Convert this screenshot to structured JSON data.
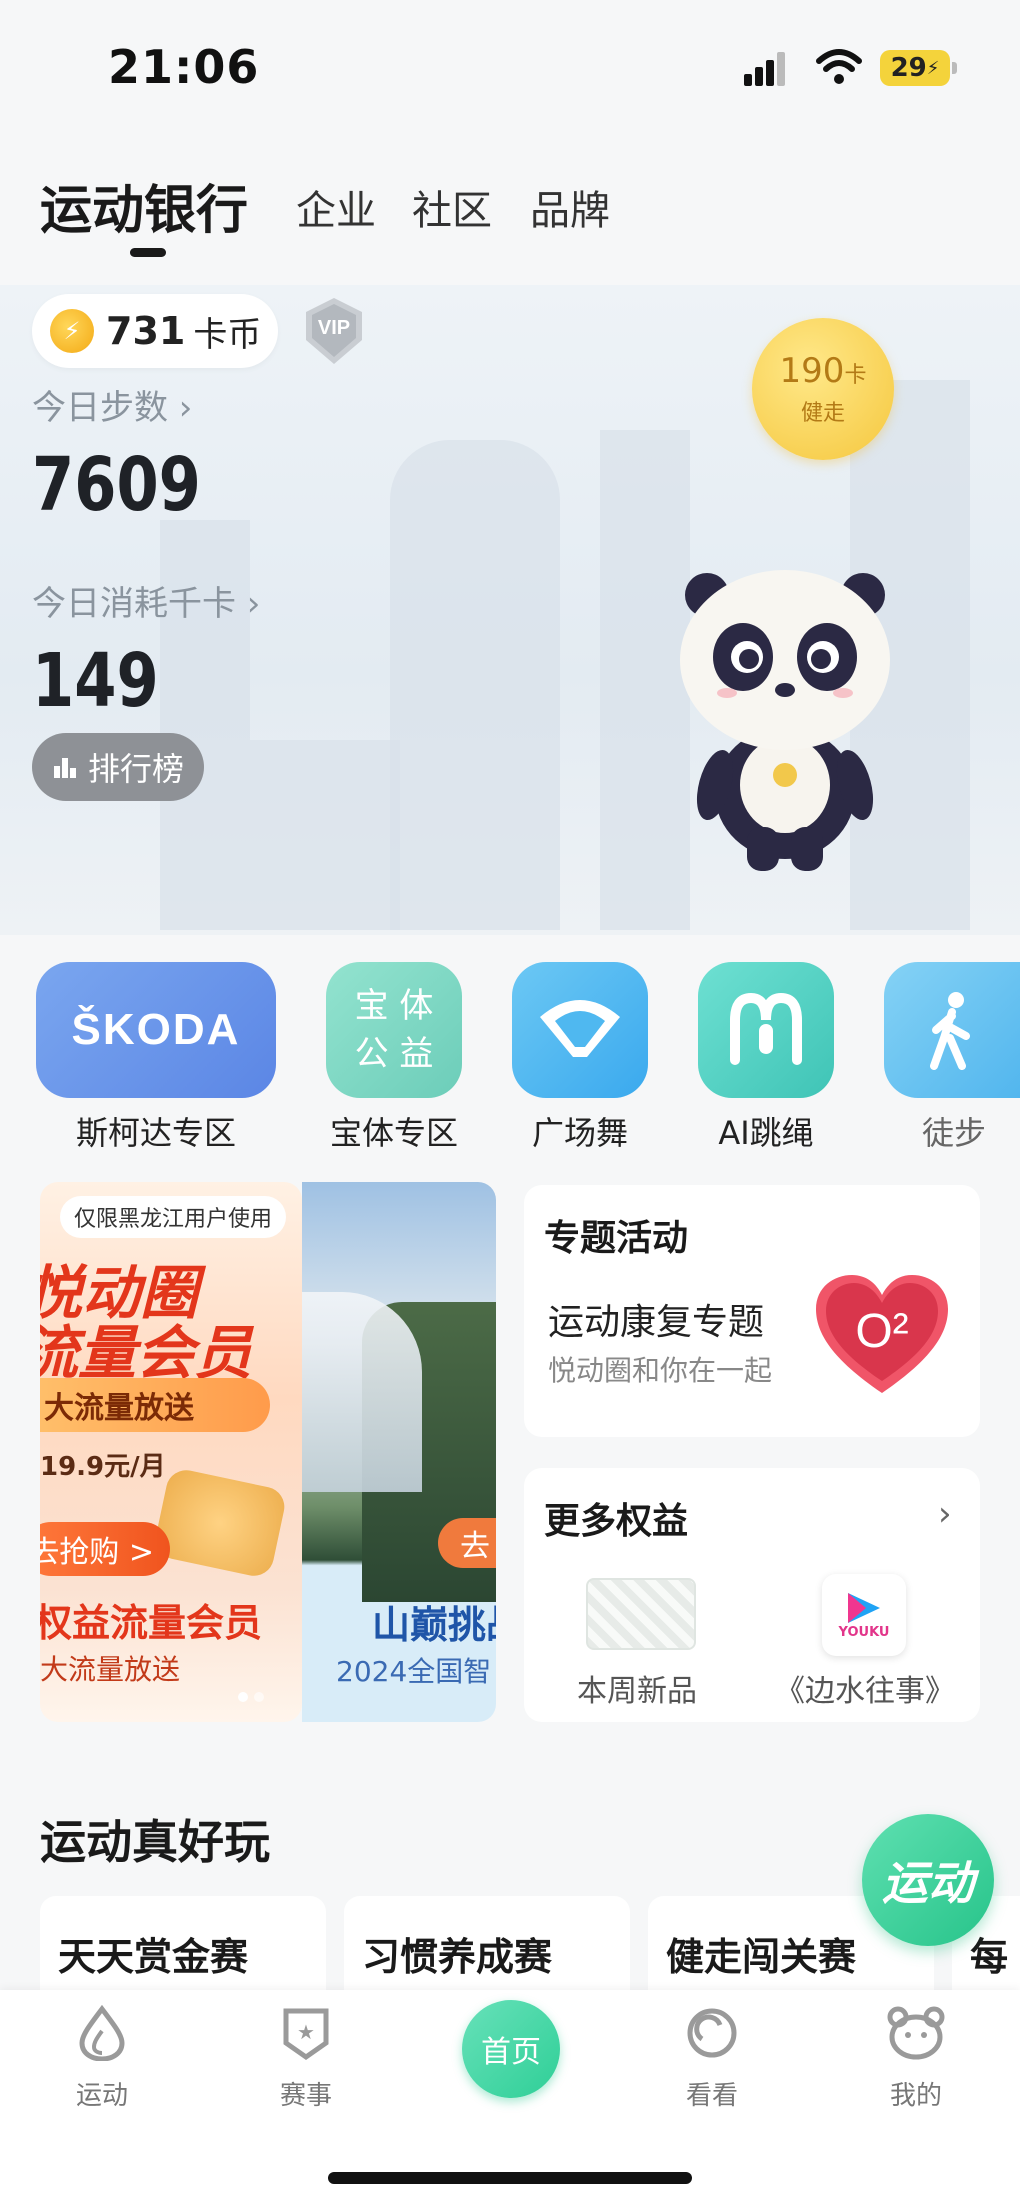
{
  "status_bar": {
    "time": "21:06",
    "battery": "29"
  },
  "top_tabs": [
    "运动银行",
    "企业",
    "社区",
    "品牌"
  ],
  "hero": {
    "coins": "731",
    "coin_unit": "卡币",
    "vip": "VIP",
    "steps_label": "今日步数",
    "steps": "7609",
    "calories_label": "今日消耗千卡",
    "calories": "149",
    "rank_button": "排行榜",
    "badge_value": "190",
    "badge_unit": "卡",
    "badge_label": "健走"
  },
  "shortcuts": [
    {
      "label": "斯柯达专区",
      "icon_text": "ŠKODA",
      "color": "#6f9be8"
    },
    {
      "label": "宝体专区",
      "icon_text": "宝 体 公 益",
      "color": "#7fd8c7"
    },
    {
      "label": "广场舞",
      "icon_text": "",
      "color": "#4fb8f0"
    },
    {
      "label": "AI跳绳",
      "icon_text": "",
      "color": "#55d3c6"
    },
    {
      "label": "徒步",
      "icon_text": "",
      "color": "#5fbfef"
    }
  ],
  "banner1": {
    "tag": "仅限黑龙江用户使用",
    "line1": "悦动圈",
    "line2": "流量会员",
    "pill": "大流量放送",
    "price": "19.9元/月",
    "cta": "去抢购 >",
    "title": "权益流量会员",
    "subtitle": "大流量放送"
  },
  "banner2": {
    "cta": "去",
    "title": "山巅挑战",
    "subtitle": "2024全国智"
  },
  "special": {
    "title": "专题活动",
    "name": "运动康复专题",
    "desc": "悦动圈和你在一起",
    "heart_text": "O²"
  },
  "benefits": {
    "title": "更多权益",
    "items": [
      "本周新品",
      "《边水往事》"
    ],
    "youku": "YOUKU"
  },
  "fun_section": {
    "title": "运动真好玩",
    "cards": [
      "天天赏金赛",
      "习惯养成赛",
      "健走闯关赛",
      "每日"
    ]
  },
  "fab": "运动",
  "bottom_nav": [
    "运动",
    "赛事",
    "首页",
    "看看",
    "我的"
  ]
}
